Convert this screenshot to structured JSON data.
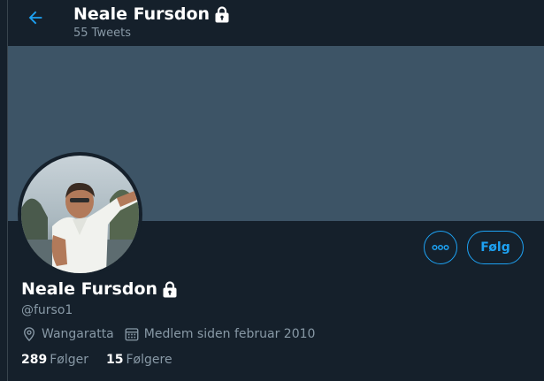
{
  "header": {
    "title": "Neale Fursdon",
    "tweet_count": "55 Tweets",
    "back_icon": "arrow-left-icon",
    "lock_icon": "lock-icon"
  },
  "profile": {
    "name": "Neale Fursdon",
    "handle": "@furso1",
    "location": "Wangaratta",
    "joined": "Medlem siden februar 2010",
    "following_count": "289",
    "following_label": "Følger",
    "followers_count": "15",
    "followers_label": "Følgere"
  },
  "actions": {
    "more_icon": "more-options-icon",
    "follow_label": "Følg"
  },
  "colors": {
    "background": "#15202b",
    "banner": "#3d5466",
    "accent": "#1da1f2",
    "secondary_text": "#8899a6",
    "primary_text": "#ffffff"
  }
}
